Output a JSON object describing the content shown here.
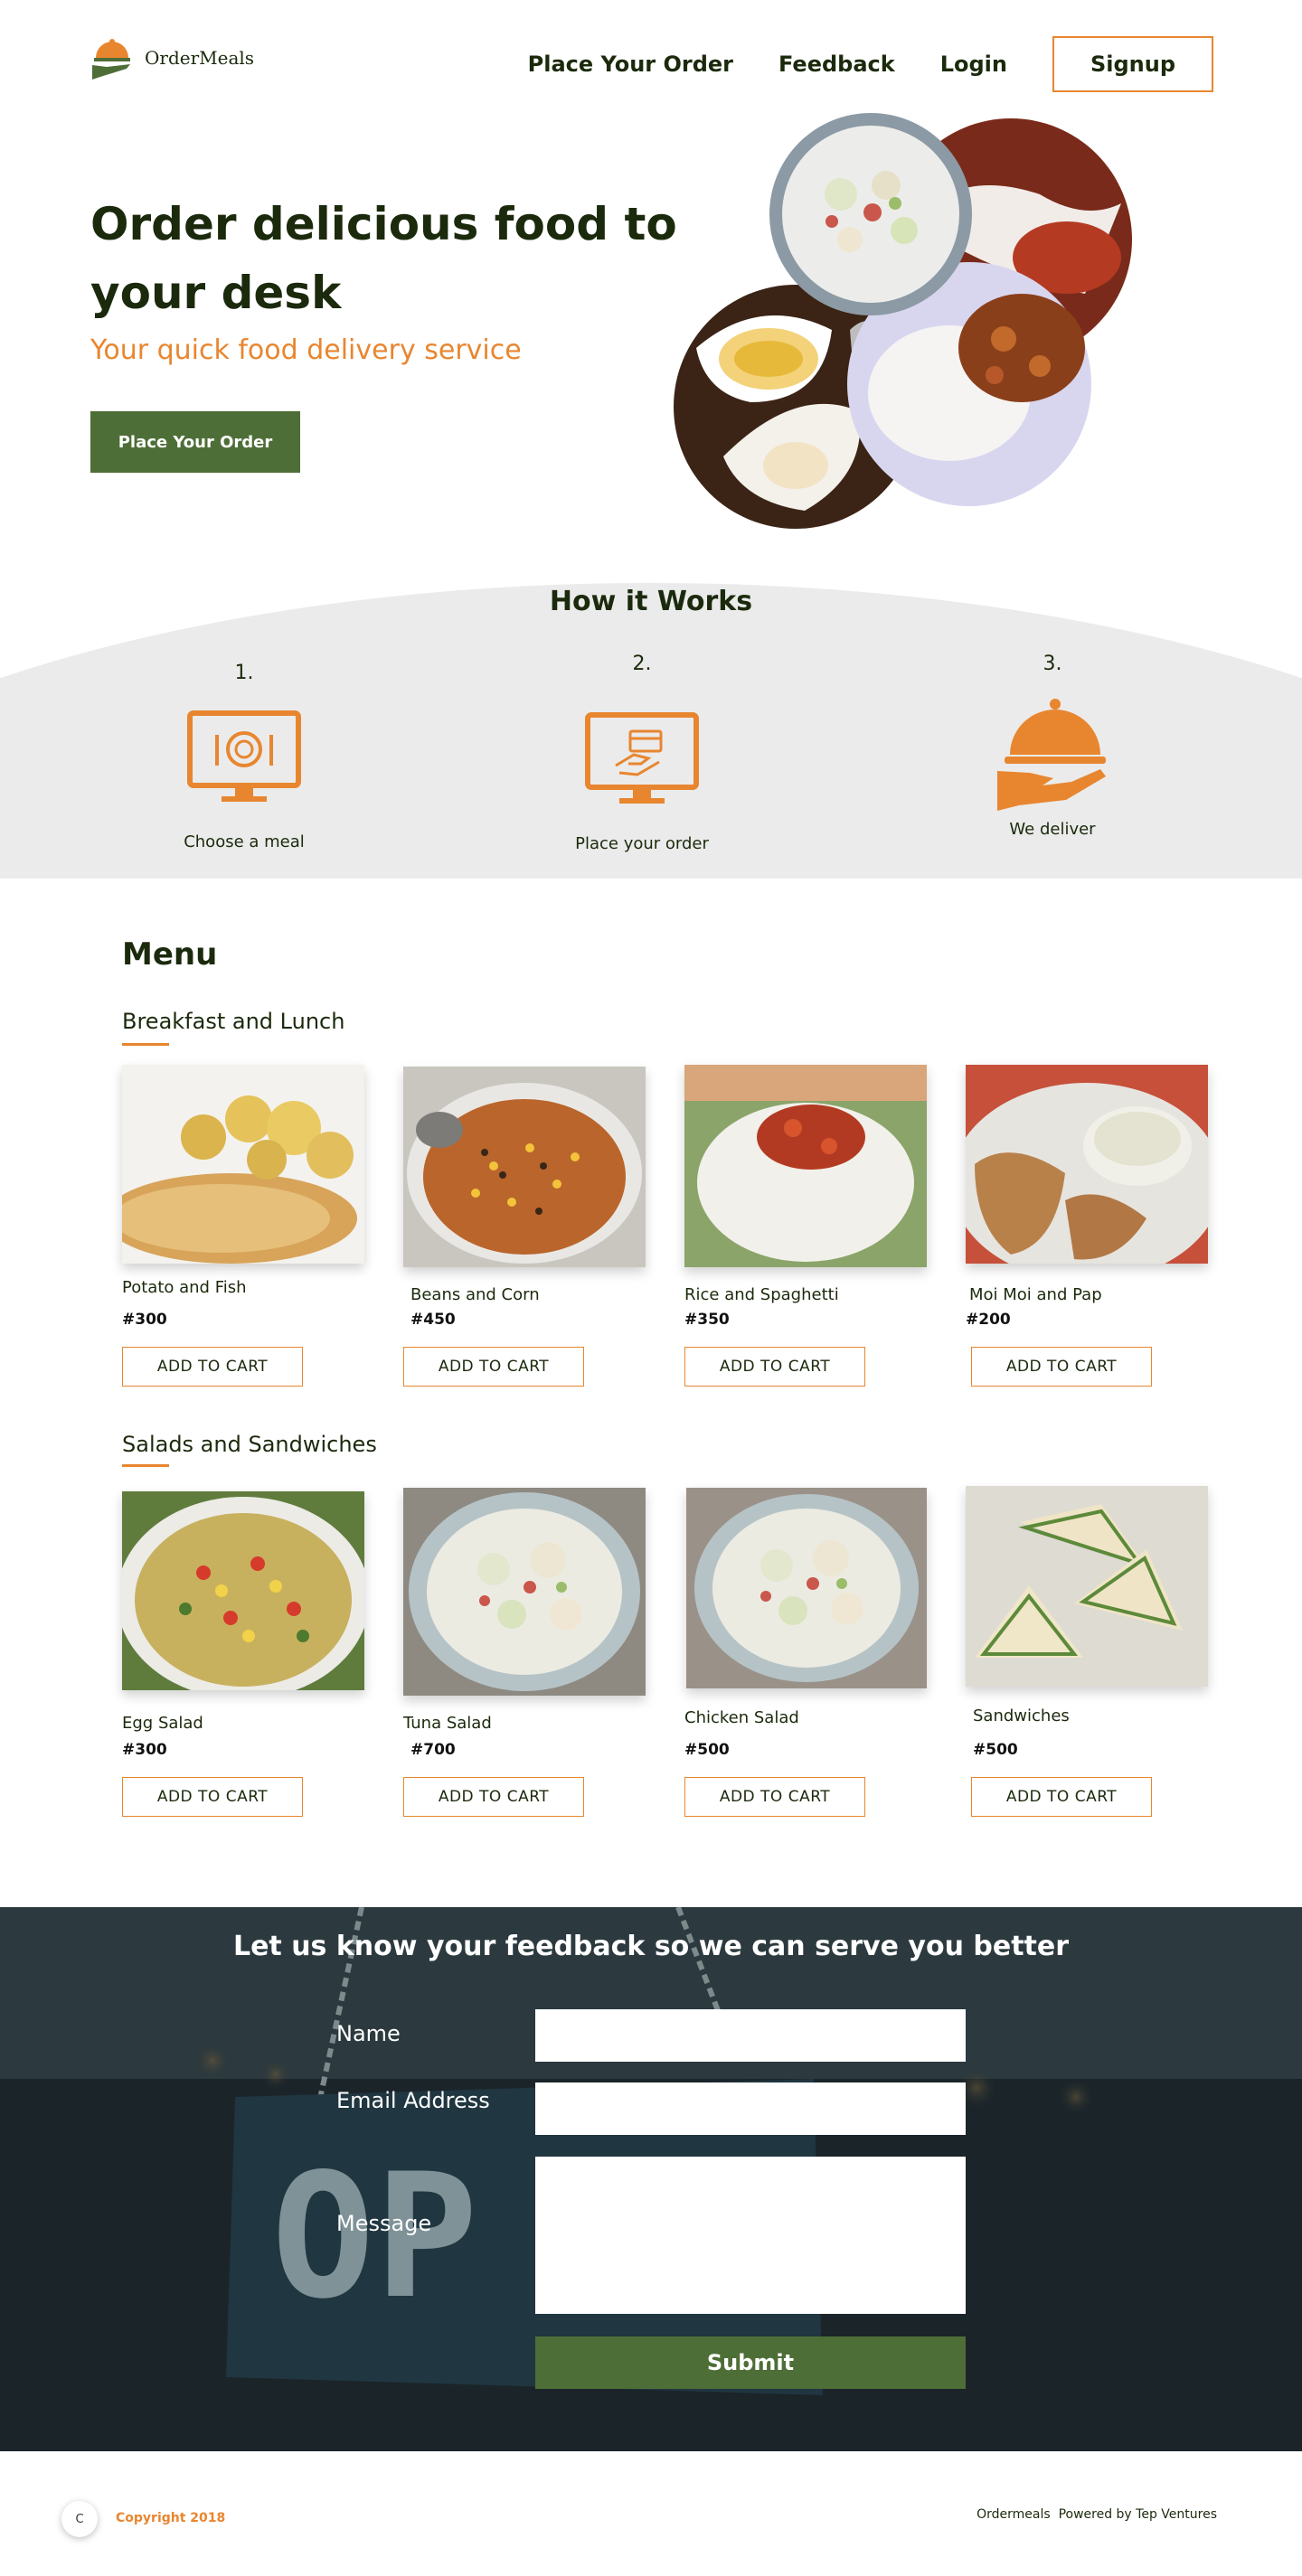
{
  "brand": {
    "name": "OrderMeals"
  },
  "nav": {
    "links": [
      "Place Your Order",
      "Feedback",
      "Login"
    ],
    "signup": "Signup"
  },
  "hero": {
    "title": "Order delicious food to your desk",
    "subtitle": "Your quick food delivery service",
    "cta": "Place Your Order"
  },
  "how": {
    "title": "How it Works",
    "steps": [
      {
        "num": "1.",
        "label": "Choose a meal",
        "icon": "monitor-meal-icon"
      },
      {
        "num": "2.",
        "label": "Place your order",
        "icon": "monitor-payment-icon"
      },
      {
        "num": "3.",
        "label": "We deliver",
        "icon": "cloche-hand-icon"
      }
    ]
  },
  "menu": {
    "title": "Menu",
    "add_label": "ADD TO CART",
    "categories": [
      {
        "title": "Breakfast and Lunch",
        "items": [
          {
            "name": "Potato and Fish",
            "price": "#300"
          },
          {
            "name": "Beans and Corn",
            "price": "#450"
          },
          {
            "name": "Rice and Spaghetti",
            "price": "#350"
          },
          {
            "name": "Moi Moi and Pap",
            "price": "#200"
          }
        ]
      },
      {
        "title": "Salads and Sandwiches",
        "items": [
          {
            "name": "Egg Salad",
            "price": "#300"
          },
          {
            "name": "Tuna Salad",
            "price": "#700"
          },
          {
            "name": "Chicken Salad",
            "price": "#500"
          },
          {
            "name": "Sandwiches",
            "price": "#500"
          }
        ]
      }
    ]
  },
  "feedback": {
    "title": "Let us know your feedback so we can serve you better",
    "name_label": "Name",
    "email_label": "Email Address",
    "message_label": "Message",
    "submit": "Submit"
  },
  "footer": {
    "cookie": "C",
    "copyright": "Copyright 2018",
    "credits": "Ordermeals  Powered by Tep Ventures"
  },
  "colors": {
    "accent": "#e8862f",
    "primary": "#4e6e37",
    "dark": "#1b2a0c",
    "section_bg": "#ebebeb"
  }
}
